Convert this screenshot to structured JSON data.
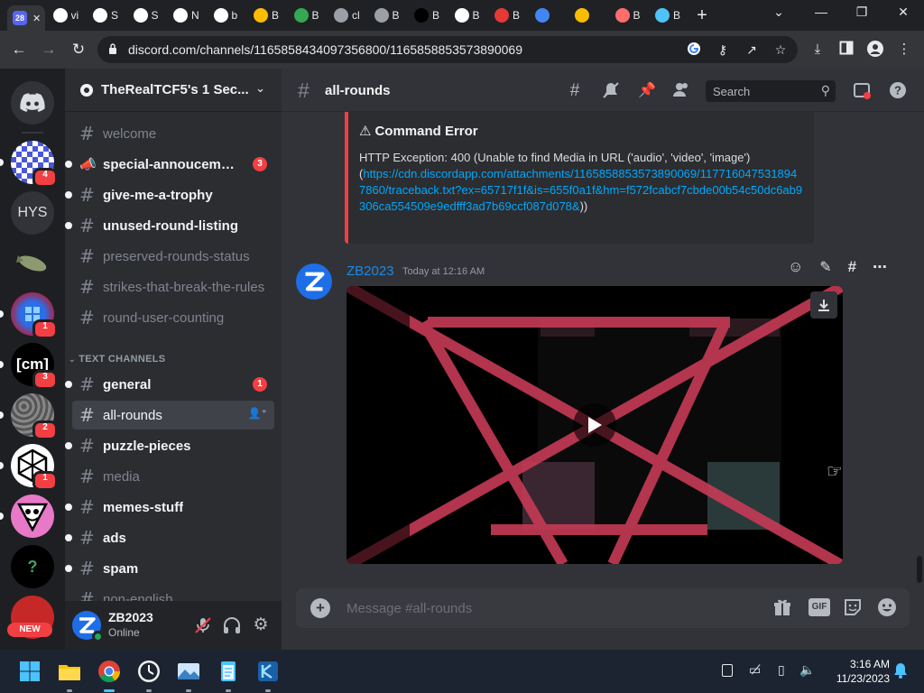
{
  "browser": {
    "tabs": [
      {
        "favicon": "discord-badge-icon",
        "badge": "28",
        "color": "#5865f2",
        "label": ""
      },
      {
        "favicon": "google-icon",
        "label": "vi",
        "color": "#ffffff"
      },
      {
        "favicon": "museum-icon",
        "label": "S",
        "color": "#ffffff"
      },
      {
        "favicon": "museum-icon",
        "label": "S",
        "color": "#ffffff"
      },
      {
        "favicon": "github-icon",
        "label": "N",
        "color": "#ffffff"
      },
      {
        "favicon": "google-icon",
        "label": "b",
        "color": "#ffffff"
      },
      {
        "favicon": "g-yellow-icon",
        "label": "B",
        "color": "#fbbc04"
      },
      {
        "favicon": "globe-icon",
        "label": "B",
        "color": "#34a853"
      },
      {
        "favicon": "globe-icon",
        "label": "cl",
        "color": "#9aa0a6"
      },
      {
        "favicon": "globe-icon",
        "label": "B",
        "color": "#9aa0a6"
      },
      {
        "favicon": "tiktok-icon",
        "label": "B",
        "color": "#000000"
      },
      {
        "favicon": "re-icon",
        "label": "B",
        "color": "#ffffff"
      },
      {
        "favicon": "red-app-icon",
        "label": "B",
        "color": "#e53935"
      },
      {
        "favicon": "bird-icon",
        "label": "",
        "color": "#4285f4"
      },
      {
        "favicon": "lightning-icon",
        "label": "",
        "color": "#fbbc04"
      },
      {
        "favicon": "planet-icon",
        "label": "B",
        "color": "#ff6d6d"
      },
      {
        "favicon": "fish-icon",
        "label": "B",
        "color": "#4fc3f7"
      }
    ],
    "new_tab": "+",
    "url": "discord.com/channels/1165858434097356800/1165858853573890069"
  },
  "server": {
    "name": "TheRealTCF5's 1 Sec...",
    "guild_badges": {
      "g1": "4",
      "g3": "1",
      "g4": "3",
      "g5": "2",
      "g6": "1"
    },
    "guild_hys": "HYS",
    "guild_cm": "[cm]",
    "guild_new": "NEW",
    "guild_q": "?"
  },
  "channels": {
    "top": [
      {
        "name": "welcome",
        "state": "muted"
      },
      {
        "name": "special-annoucements",
        "state": "unread",
        "badge": "3",
        "icon": "announcement-icon"
      },
      {
        "name": "give-me-a-trophy",
        "state": "unread"
      },
      {
        "name": "unused-round-listing",
        "state": "unread"
      },
      {
        "name": "preserved-rounds-status",
        "state": "muted"
      },
      {
        "name": "strikes-that-break-the-rules",
        "state": "muted"
      },
      {
        "name": "round-user-counting",
        "state": "muted"
      }
    ],
    "category": "TEXT CHANNELS",
    "text": [
      {
        "name": "general",
        "state": "unread",
        "badge": "1"
      },
      {
        "name": "all-rounds",
        "state": "selected"
      },
      {
        "name": "puzzle-pieces",
        "state": "unread"
      },
      {
        "name": "media",
        "state": "muted"
      },
      {
        "name": "memes-stuff",
        "state": "unread"
      },
      {
        "name": "ads",
        "state": "unread"
      },
      {
        "name": "spam",
        "state": "unread"
      },
      {
        "name": "non-english",
        "state": "muted"
      }
    ]
  },
  "user": {
    "name": "ZB2023",
    "status": "Online"
  },
  "header": {
    "channel": "all-rounds",
    "search_placeholder": "Search"
  },
  "embed": {
    "title": "Command Error",
    "body": "HTTP Exception: 400 (Unable to find Media in URL ('audio', 'video', 'image')",
    "link_open": "(",
    "link": "https://cdn.discordapp.com/attachments/1165858853573890069/1177160475318947860/traceback.txt?ex=65717f1f&is=655f0a1f&hm=f572fcabcf7cbde00b54c50dc6ab9306ca554509e9edfff3ad7b69ccf087d078&",
    "link_close": "))"
  },
  "message": {
    "author": "ZB2023",
    "timestamp": "Today at 12:16 AM"
  },
  "composer": {
    "placeholder": "Message #all-rounds",
    "gif": "GIF"
  },
  "taskbar": {
    "time": "3:16 AM",
    "date": "11/23/2023"
  },
  "colors": {
    "accent": "#5865f2",
    "danger": "#f23f43",
    "link": "#00a8fc",
    "online": "#23a55a"
  }
}
